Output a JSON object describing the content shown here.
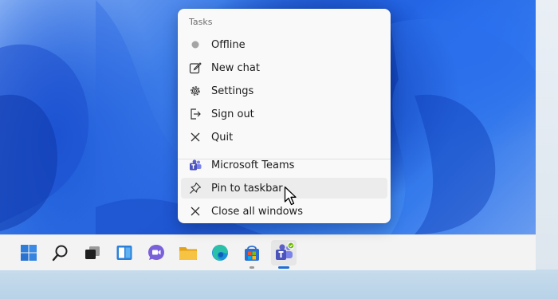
{
  "context_menu": {
    "header": "Tasks",
    "items": [
      {
        "label": "Offline",
        "icon": "status-dot-icon"
      },
      {
        "label": "New chat",
        "icon": "compose-icon"
      },
      {
        "label": "Settings",
        "icon": "gear-icon"
      },
      {
        "label": "Sign out",
        "icon": "sign-out-icon"
      },
      {
        "label": "Quit",
        "icon": "close-icon"
      }
    ],
    "app_items": [
      {
        "label": "Microsoft Teams",
        "icon": "teams-icon"
      },
      {
        "label": "Pin to taskbar",
        "icon": "pin-icon"
      },
      {
        "label": "Close all windows",
        "icon": "close-icon"
      }
    ]
  },
  "taskbar": {
    "icons": [
      "windows-start-icon",
      "search-icon",
      "task-view-icon",
      "widgets-icon",
      "chat-icon",
      "file-explorer-icon",
      "edge-icon",
      "store-icon",
      "teams-icon"
    ]
  },
  "colors": {
    "accent": "#1d6fd6",
    "teams": "#5b5fc7",
    "status_available": "#6bb700"
  }
}
